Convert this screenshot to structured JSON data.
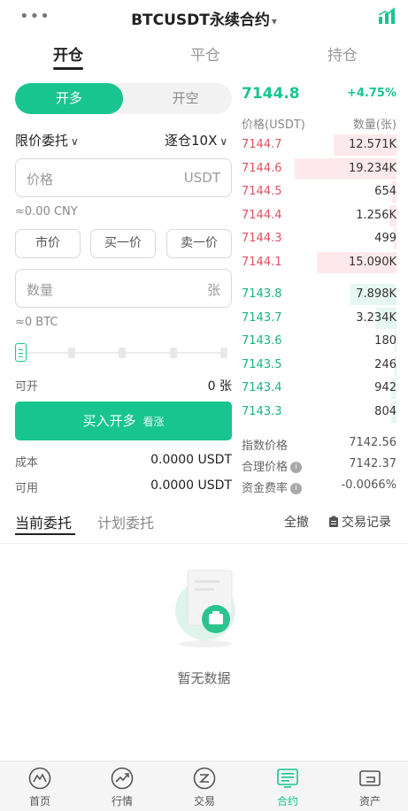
{
  "header": {
    "title": "BTCUSDT永续合约",
    "caret": "▾",
    "more": "•••"
  },
  "tabs": [
    "开仓",
    "平仓",
    "持仓"
  ],
  "trade": {
    "toggle_long": "开多",
    "toggle_short": "开空",
    "order_type": "限价委托",
    "margin_mode": "逐仓10X",
    "price_placeholder": "价格",
    "price_unit": "USDT",
    "price_hint": "≈0.00 CNY",
    "price_buttons": [
      "市价",
      "买一价",
      "卖一价"
    ],
    "qty_placeholder": "数量",
    "qty_unit": "张",
    "qty_hint": "≈0 BTC",
    "available_label": "可开",
    "available_value": "0 张",
    "buy_label": "买入开多",
    "buy_sub": "看涨",
    "cost_label": "成本",
    "cost_value": "0.0000 USDT",
    "usable_label": "可用",
    "usable_value": "0.0000 USDT"
  },
  "orderbook": {
    "last_price": "7144.8",
    "change": "+4.75%",
    "price_header": "价格(USDT)",
    "qty_header": "数量(张)",
    "asks": [
      {
        "price": "7144.7",
        "qty": "12.571K",
        "depth": 0.62
      },
      {
        "price": "7144.6",
        "qty": "19.234K",
        "depth": 1.0
      },
      {
        "price": "7144.5",
        "qty": "654",
        "depth": 0.04
      },
      {
        "price": "7144.4",
        "qty": "1.256K",
        "depth": 0.07
      },
      {
        "price": "7144.3",
        "qty": "499",
        "depth": 0.03
      },
      {
        "price": "7144.1",
        "qty": "15.090K",
        "depth": 0.78
      }
    ],
    "bids": [
      {
        "price": "7143.8",
        "qty": "7.898K",
        "depth": 0.45
      },
      {
        "price": "7143.7",
        "qty": "3.234K",
        "depth": 0.2
      },
      {
        "price": "7143.6",
        "qty": "180",
        "depth": 0.02
      },
      {
        "price": "7143.5",
        "qty": "246",
        "depth": 0.02
      },
      {
        "price": "7143.4",
        "qty": "942",
        "depth": 0.05
      },
      {
        "price": "7143.3",
        "qty": "804",
        "depth": 0.05
      }
    ],
    "index_label": "指数价格",
    "index_value": "7142.56",
    "fair_label": "合理价格",
    "fair_value": "7142.37",
    "funding_label": "资金费率",
    "funding_value": "-0.0066%"
  },
  "orders": {
    "tab_current": "当前委托",
    "tab_plan": "计划委托",
    "cancel_all": "全撤",
    "history": "交易记录",
    "empty_text": "暂无数据"
  },
  "nav": [
    {
      "label": "首页",
      "icon": "home-icon"
    },
    {
      "label": "行情",
      "icon": "market-icon"
    },
    {
      "label": "交易",
      "icon": "trade-icon"
    },
    {
      "label": "合约",
      "icon": "contract-icon"
    },
    {
      "label": "资产",
      "icon": "wallet-icon"
    }
  ],
  "colors": {
    "accent": "#18c58f",
    "ask": "#e0515e",
    "bid": "#18b380"
  }
}
